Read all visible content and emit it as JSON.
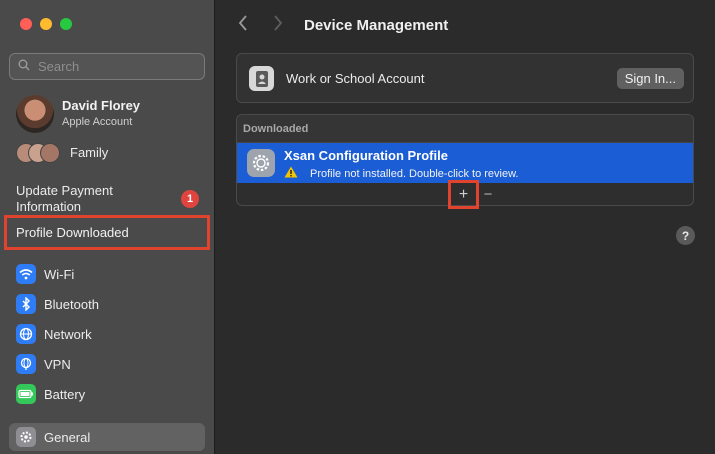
{
  "sidebar": {
    "search_placeholder": "Search",
    "user": {
      "name": "David Florey",
      "subtitle": "Apple Account"
    },
    "family_label": "Family",
    "update_payment": "Update Payment Information",
    "badge_count": "1",
    "profile_downloaded": "Profile Downloaded",
    "items": [
      {
        "label": "Wi-Fi",
        "icon": "wifi-icon",
        "color": "#2f7df6"
      },
      {
        "label": "Bluetooth",
        "icon": "bluetooth-icon",
        "color": "#2f7df6"
      },
      {
        "label": "Network",
        "icon": "globe-icon",
        "color": "#2f7df6"
      },
      {
        "label": "VPN",
        "icon": "vpn-globe-icon",
        "color": "#2f7df6"
      },
      {
        "label": "Battery",
        "icon": "battery-icon",
        "color": "#34c759"
      },
      {
        "label": "General",
        "icon": "gear-icon",
        "color": "#8e8e93"
      }
    ]
  },
  "main": {
    "title": "Device Management",
    "account_label": "Work or School Account",
    "sign_in_label": "Sign In...",
    "downloaded_header": "Downloaded",
    "profile": {
      "name": "Xsan Configuration Profile",
      "status": "Profile not installed. Double-click to review."
    },
    "add_label": "+",
    "remove_label": "−",
    "help_label": "?"
  },
  "colors": {
    "selection": "#1b5dd4",
    "highlight": "#e0442f"
  }
}
